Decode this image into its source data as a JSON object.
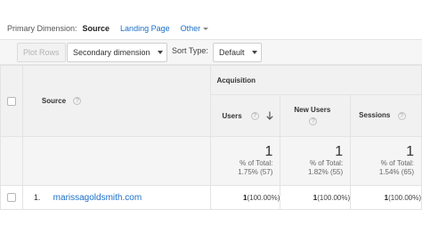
{
  "primary_dimension": {
    "label": "Primary Dimension:",
    "selected": "Source",
    "options": [
      "Landing Page"
    ],
    "other_label": "Other"
  },
  "toolbar": {
    "plot_rows_label": "Plot Rows",
    "secondary_dimension_label": "Secondary dimension",
    "sort_type_label": "Sort Type:",
    "sort_type_value": "Default"
  },
  "table": {
    "dimension_header": "Source",
    "group_header": "Acquisition",
    "columns": [
      {
        "label": "Users",
        "sorted": true
      },
      {
        "label": "New Users",
        "sorted": false
      },
      {
        "label": "Sessions",
        "sorted": false
      }
    ],
    "totals": [
      {
        "value": "1",
        "line1": "% of Total:",
        "line2": "1.75% (57)"
      },
      {
        "value": "1",
        "line1": "% of Total:",
        "line2": "1.82% (55)"
      },
      {
        "value": "1",
        "line1": "% of Total:",
        "line2": "1.54% (65)"
      }
    ],
    "rows": [
      {
        "index": "1.",
        "source": "marissagoldsmith.com",
        "cells": [
          {
            "value": "1",
            "pct": "(100.00%)"
          },
          {
            "value": "1",
            "pct": "(100.00%)"
          },
          {
            "value": "1",
            "pct": "(100.00%)"
          }
        ]
      }
    ]
  },
  "icons": {
    "help": "question-circle-icon",
    "sort": "arrow-down-icon",
    "dropdown": "caret-down-icon"
  }
}
